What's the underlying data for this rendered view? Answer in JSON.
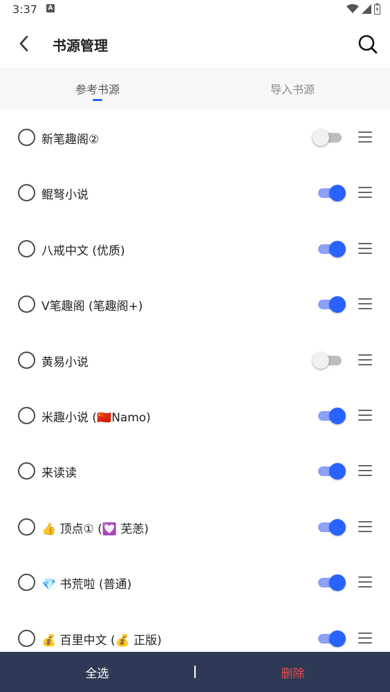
{
  "status": {
    "time": "3:37",
    "badge": "A"
  },
  "header": {
    "title": "书源管理",
    "back_icon": "chevron-left-icon",
    "search_icon": "search-icon"
  },
  "tabs": [
    {
      "label": "参考书源",
      "active": true
    },
    {
      "label": "导入书源",
      "active": false
    }
  ],
  "sources": [
    {
      "name": "新笔趣阁②",
      "enabled": false
    },
    {
      "name": "鲲弩小说",
      "enabled": true
    },
    {
      "name": "八戒中文 (优质)",
      "enabled": true
    },
    {
      "name": "V笔趣阁 (笔趣阁+)",
      "enabled": true
    },
    {
      "name": "黄易小说",
      "enabled": false
    },
    {
      "name": "米趣小说 (🇨🇳Namo)",
      "enabled": true
    },
    {
      "name": "来读读",
      "enabled": true
    },
    {
      "name": "👍 顶点① (💟 芜恙)",
      "enabled": true
    },
    {
      "name": "💎 书荒啦 (普通)",
      "enabled": true
    },
    {
      "name": "💰 百里中文 (💰 正版)",
      "enabled": true
    }
  ],
  "bottom": {
    "select_all": "全选",
    "delete": "删除"
  },
  "colors": {
    "accent": "#2962ff",
    "bottom_bar": "#2e3a55",
    "delete": "#e94a4a"
  }
}
